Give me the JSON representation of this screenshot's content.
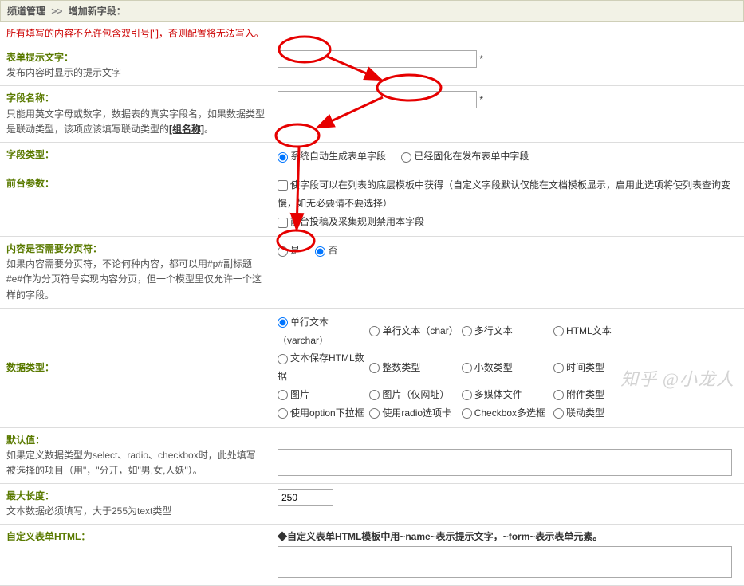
{
  "breadcrumb": {
    "a": "频道管理",
    "sep": ">>",
    "b": "增加新字段："
  },
  "warning": "所有填写的内容不允许包含双引号[\"]，否则配置将无法写入。",
  "rows": {
    "prompt": {
      "title": "表单提示文字：",
      "desc": "发布内容时显示的提示文字",
      "star": "*"
    },
    "fieldname": {
      "title": "字段名称：",
      "desc1": "只能用英文字母或数字，数据表的真实字段名，如果数据类型是联动类型，该项应该填写联动类型的",
      "link": "[组名称]",
      "desc2": "。",
      "star": "*"
    },
    "fieldtype": {
      "title": "字段类型：",
      "opt1": "系统自动生成表单字段",
      "opt2": "已经固化在发布表单中字段"
    },
    "frontparam": {
      "title": "前台参数：",
      "chk1": "使字段可以在列表的底层模板中获得（自定义字段默认仅能在文档模板显示，启用此选项将使列表查询变慢，如无必要请不要选择）",
      "chk2": "前台投稿及采集规则禁用本字段"
    },
    "pagebreak": {
      "title": "内容是否需要分页符：",
      "desc": "如果内容需要分页符，不论何种内容，都可以用#p#副标题#e#作为分页符号实现内容分页，但一个模型里仅允许一个这样的字段。",
      "yes": "是",
      "no": "否"
    },
    "datatype": {
      "title": "数据类型：",
      "opts": [
        "单行文本（varchar）",
        "单行文本（char）",
        "多行文本",
        "HTML文本",
        "文本保存HTML数据",
        "整数类型",
        "小数类型",
        "时间类型",
        "图片",
        "图片（仅网址）",
        "多媒体文件",
        "附件类型",
        "使用option下拉框",
        "使用radio选项卡",
        "Checkbox多选框",
        "联动类型"
      ]
    },
    "defaultval": {
      "title": "默认值：",
      "desc": "如果定义数据类型为select、radio、checkbox时，此处填写被选择的项目（用\"，\"分开，如\"男,女,人妖\"）。"
    },
    "maxlen": {
      "title": "最大长度：",
      "desc": "文本数据必须填写，大于255为text类型",
      "value": "250"
    },
    "customhtml": {
      "title": "自定义表单HTML：",
      "note": "◆自定义表单HTML模板中用~name~表示提示文字，~form~表示表单元素。"
    }
  },
  "watermark": "知乎 @小龙人"
}
